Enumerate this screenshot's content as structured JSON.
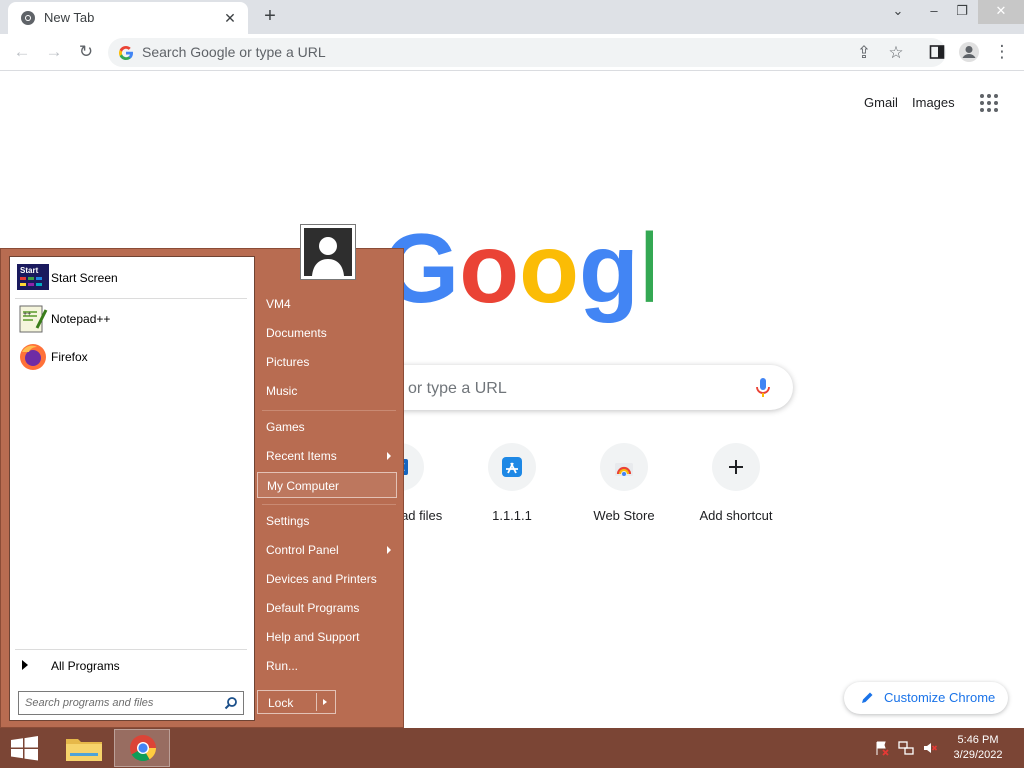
{
  "browser": {
    "tab": {
      "title": "New Tab"
    },
    "omnibox": {
      "placeholder": "Search Google or type a URL"
    }
  },
  "ntp": {
    "header_links": [
      "Gmail",
      "Images"
    ],
    "search": {
      "placeholder_visible": "or type a URL"
    },
    "shortcuts": [
      {
        "label": "Download files",
        "icon": "x-icon"
      },
      {
        "label": "1.1.1.1",
        "icon": "app-store-icon"
      },
      {
        "label": "Web Store",
        "icon": "web-store-icon"
      },
      {
        "label": "Add shortcut",
        "icon": "plus-icon"
      }
    ],
    "customize_label": "Customize Chrome"
  },
  "start_menu": {
    "pinned": [
      {
        "label": "Start Screen",
        "icon": "start-screen-icon"
      }
    ],
    "recent": [
      {
        "label": "Notepad++",
        "icon": "notepadpp-icon"
      },
      {
        "label": "Firefox",
        "icon": "firefox-icon"
      }
    ],
    "all_programs": "All Programs",
    "search_placeholder": "Search programs and files",
    "right_items": [
      {
        "label": "VM4",
        "submenu": false
      },
      {
        "label": "Documents",
        "submenu": false
      },
      {
        "label": "Pictures",
        "submenu": false
      },
      {
        "label": "Music",
        "submenu": false
      },
      {
        "label": "Games",
        "submenu": false
      },
      {
        "label": "Recent Items",
        "submenu": true
      },
      {
        "label": "My Computer",
        "submenu": false,
        "selected": true
      },
      {
        "label": "Settings",
        "submenu": false
      },
      {
        "label": "Control Panel",
        "submenu": true
      },
      {
        "label": "Devices and Printers",
        "submenu": false
      },
      {
        "label": "Default Programs",
        "submenu": false
      },
      {
        "label": "Help and Support",
        "submenu": false
      },
      {
        "label": "Run...",
        "submenu": false
      }
    ],
    "lock_label": "Lock"
  },
  "taskbar": {
    "time": "5:46 PM",
    "date": "3/29/2022"
  },
  "colors": {
    "start_menu_bg": "#b86c51",
    "taskbar_bg": "#7b4535",
    "chrome_frame": "#dee1e6",
    "accent_blue": "#1a73e8"
  }
}
